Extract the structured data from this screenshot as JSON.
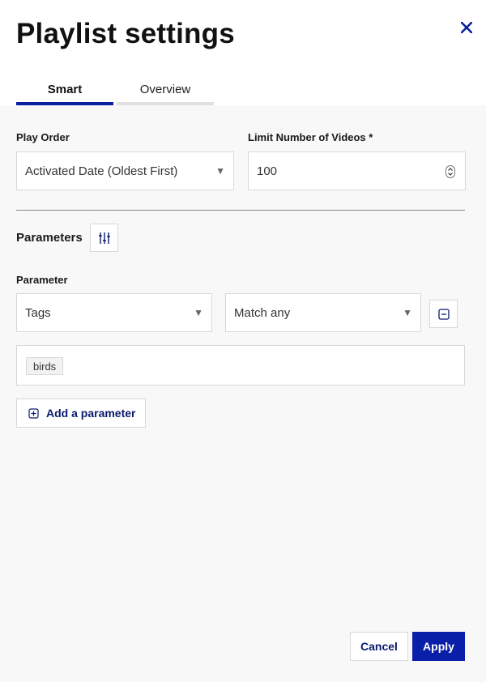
{
  "dialog": {
    "title": "Playlist settings",
    "close_icon": "close-icon"
  },
  "tabs": [
    {
      "label": "Smart",
      "active": true
    },
    {
      "label": "Overview",
      "active": false
    }
  ],
  "play_order": {
    "label": "Play Order",
    "value": "Activated Date (Oldest First)"
  },
  "limit": {
    "label": "Limit Number of Videos *",
    "value": "100"
  },
  "parameters": {
    "title": "Parameters",
    "settings_icon": "sliders-icon",
    "param_label": "Parameter",
    "field_value": "Tags",
    "match_value": "Match any",
    "remove_icon": "minus-square-icon",
    "tags": [
      "birds"
    ],
    "add_label": "Add a parameter",
    "add_icon": "plus-square-icon"
  },
  "actions": {
    "cancel": "Cancel",
    "apply": "Apply"
  },
  "colors": {
    "accent": "#0a1fa8",
    "link": "#0a1a6e"
  }
}
